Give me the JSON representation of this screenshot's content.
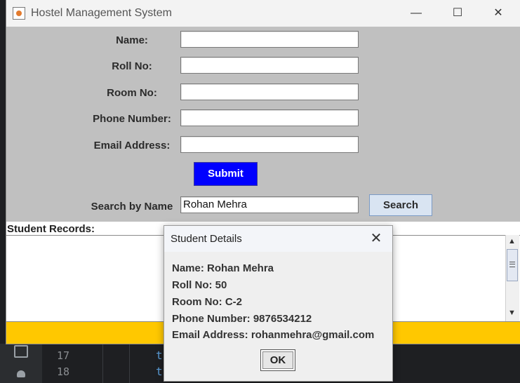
{
  "window": {
    "title": "Hostel Management System",
    "controls": {
      "minimize": "—",
      "maximize": "☐",
      "close": "✕"
    }
  },
  "form": {
    "name_label": "Name:",
    "roll_label": "Roll No:",
    "room_label": "Room No:",
    "phone_label": "Phone Number:",
    "email_label": "Email Address:",
    "name_value": "",
    "roll_value": "",
    "room_value": "",
    "phone_value": "",
    "email_value": "",
    "submit_label": "Submit"
  },
  "search": {
    "label": "Search by Name",
    "value": "Rohan Mehra",
    "button_label": "Search"
  },
  "records": {
    "label": "Student Records:"
  },
  "dialog": {
    "title": "Student Details",
    "close": "✕",
    "name": "Name: Rohan Mehra",
    "roll": "Roll No: 50",
    "room": "Room No: C-2",
    "phone": "Phone Number: 9876534212",
    "email": "Email Address: rohanmehra@gmail.com",
    "ok_label": "OK"
  },
  "ide": {
    "line_17": "17",
    "line_18": "18",
    "code_17": "t",
    "code_18": "t"
  },
  "colors": {
    "submit_bg": "#0000ff",
    "status_bar": "#ffc800",
    "form_bg": "#c0c0c0"
  }
}
